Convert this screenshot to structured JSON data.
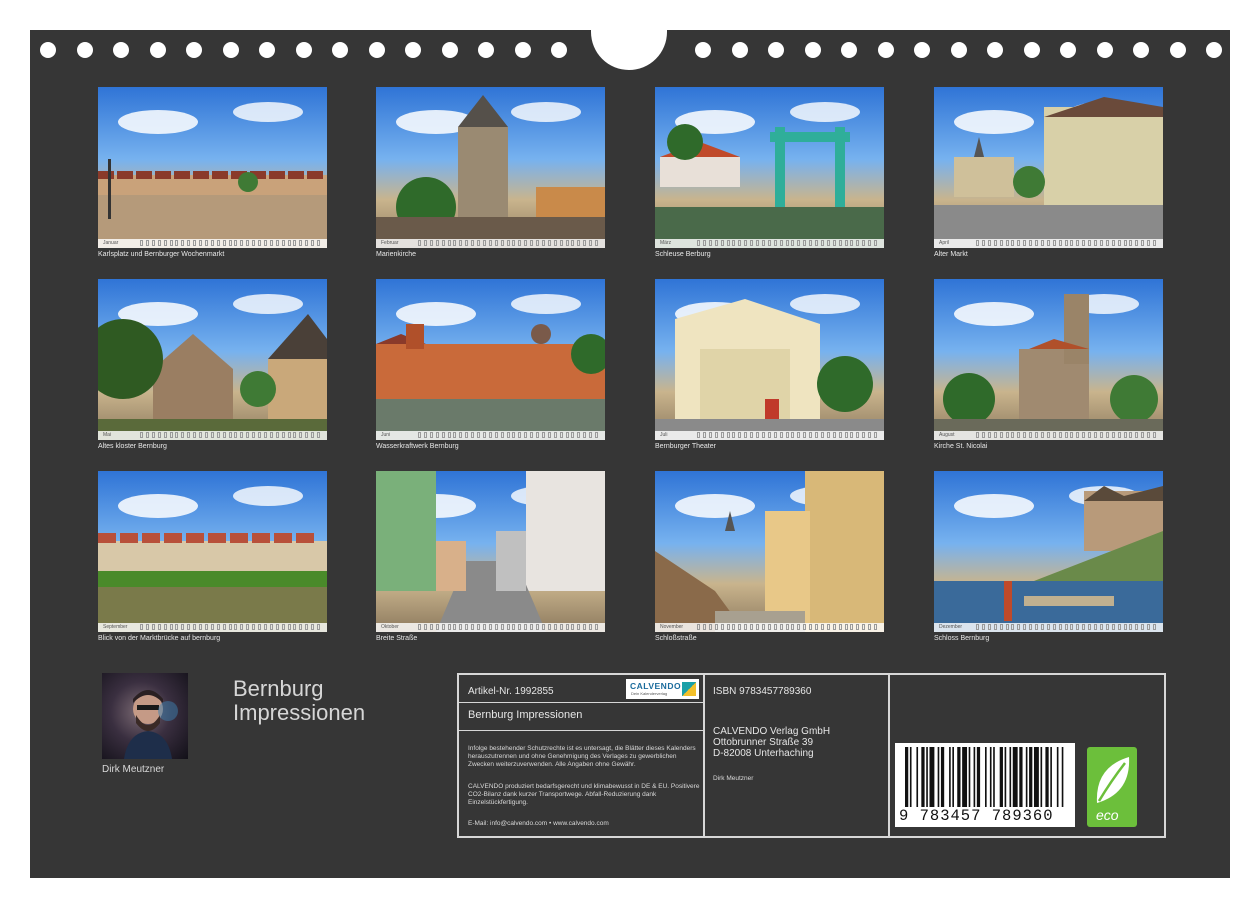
{
  "photos": [
    {
      "caption": "Karlsplatz und Bernburger Wochenmarkt",
      "month": "Januar",
      "scene": "square"
    },
    {
      "caption": "Marienkirche",
      "month": "Februar",
      "scene": "church-tower"
    },
    {
      "caption": "Schleuse Berburg",
      "month": "März",
      "scene": "lock"
    },
    {
      "caption": "Alter Markt",
      "month": "April",
      "scene": "market"
    },
    {
      "caption": "Altes kloster Bernburg",
      "month": "Mai",
      "scene": "cloister"
    },
    {
      "caption": "Wasserkraftwerk Bernburg",
      "month": "Juni",
      "scene": "powerplant"
    },
    {
      "caption": "Bernburger Theater",
      "month": "Juli",
      "scene": "theater"
    },
    {
      "caption": "Kirche St. Nicolai",
      "month": "August",
      "scene": "nicolai"
    },
    {
      "caption": "Blick von der Marktbrücke auf bernburg",
      "month": "September",
      "scene": "river"
    },
    {
      "caption": "Breite Straße",
      "month": "Oktober",
      "scene": "street"
    },
    {
      "caption": "Schloßstraße",
      "month": "November",
      "scene": "castle-street"
    },
    {
      "caption": "Schloss Bernburg",
      "month": "Dezember",
      "scene": "castle"
    }
  ],
  "author": {
    "name": "Dirk Meutzner"
  },
  "calendar_title": {
    "line1": "Bernburg",
    "line2": "Impressionen"
  },
  "info": {
    "article": "Artikel-Nr. 1992855",
    "product_title": "Bernburg Impressionen",
    "legal_text": "Infolge bestehender Schutzrechte ist es untersagt, die Blätter dieses Kalenders herauszutrennen und ohne Genehmigung des Verlages zu gewerblichen Zwecken weiterzuverwenden. Alle Angaben ohne Gewähr.",
    "eco_text": "CALVENDO produziert bedarfsgerecht und klimabewusst in DE & EU. Positivere CO2-Bilanz dank kurzer Transportwege. Abfall-Reduzierung dank Einzelstückfertigung.",
    "contact": "E-Mail: info@calvendo.com • www.calvendo.com",
    "isbn": "ISBN 9783457789360",
    "publisher_line1": "CALVENDO Verlag GmbH",
    "publisher_line2": "Ottobrunner Straße 39",
    "publisher_line3": "D-82008 Unterhaching",
    "author_small": "Dirk Meutzner",
    "brand": "CALVENDO",
    "brand_sub": "Dein Kalenderverlag",
    "barcode_digits": "9 783457 789360",
    "eco_label": "eco"
  },
  "colors": {
    "background": "#363636",
    "text": "#d6d6d6",
    "border": "#d7d7d7",
    "eco": "#6cbf3b"
  }
}
